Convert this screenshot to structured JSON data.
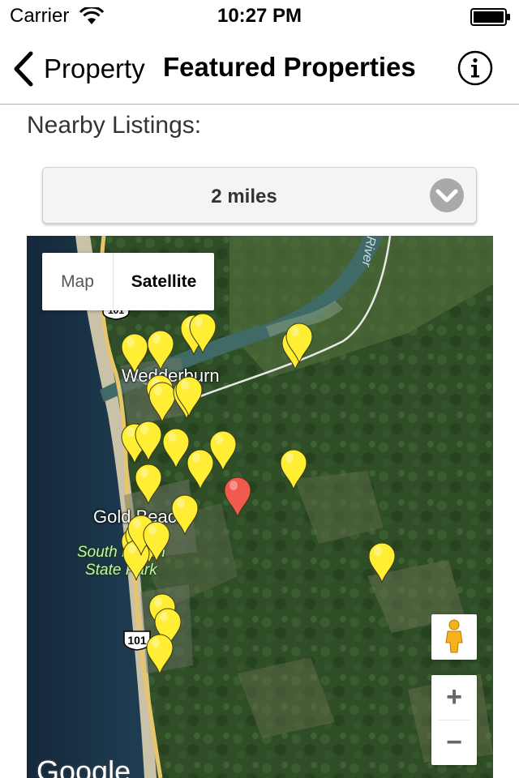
{
  "status_bar": {
    "carrier": "Carrier",
    "time": "10:27 PM",
    "wifi_icon": "wifi-icon",
    "battery_icon": "battery-full-icon"
  },
  "nav_bar": {
    "back_label": "Property",
    "title": "Featured Properties",
    "info_icon": "info-icon"
  },
  "content": {
    "nearby_label": "Nearby Listings:",
    "distance_value": "2 miles"
  },
  "map": {
    "type_options": [
      "Map",
      "Satellite"
    ],
    "selected_type": "Satellite",
    "labels": {
      "town_north": "Wedderburn",
      "town_south": "Gold Beach",
      "park_line1": "South Beach",
      "park_line2": "State Park",
      "river": "River",
      "route_north": "101",
      "route_south": "101"
    },
    "zoom_in": "+",
    "zoom_out": "−",
    "attribution": "Google",
    "colors": {
      "listing_marker": "#ffee33",
      "current_marker": "#f15a4c"
    },
    "markers": {
      "listing_count": 28,
      "current_count": 1
    }
  }
}
